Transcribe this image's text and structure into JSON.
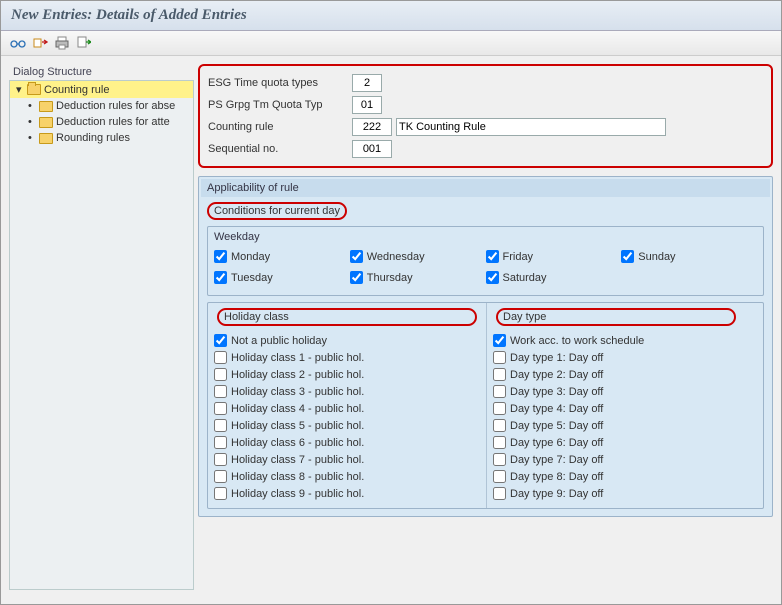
{
  "title": "New Entries: Details of Added Entries",
  "sidebar": {
    "title": "Dialog Structure",
    "items": [
      {
        "label": "Counting rule",
        "selected": true,
        "open": true
      },
      {
        "label": "Deduction rules for abse",
        "selected": false
      },
      {
        "label": "Deduction rules for atte",
        "selected": false
      },
      {
        "label": "Rounding rules",
        "selected": false
      }
    ]
  },
  "header_fields": {
    "esg_label": "ESG Time quota types",
    "esg_value": "2",
    "psgrp_label": "PS Grpg Tm Quota Typ",
    "psgrp_value": "01",
    "countrule_label": "Counting rule",
    "countrule_value": "222",
    "countrule_desc": "TK Counting Rule",
    "seqno_label": "Sequential no.",
    "seqno_value": "001"
  },
  "applicability_title": "Applicability of rule",
  "conditions_title": "Conditions for current day",
  "weekday_title": "Weekday",
  "weekdays": [
    {
      "label": "Monday",
      "checked": true
    },
    {
      "label": "Wednesday",
      "checked": true
    },
    {
      "label": "Friday",
      "checked": true
    },
    {
      "label": "Sunday",
      "checked": true
    },
    {
      "label": "Tuesday",
      "checked": true
    },
    {
      "label": "Thursday",
      "checked": true
    },
    {
      "label": "Saturday",
      "checked": true
    }
  ],
  "holiday_title": "Holiday class",
  "holiday_items": [
    {
      "label": "Not a public holiday",
      "checked": true
    },
    {
      "label": "Holiday class 1 - public hol.",
      "checked": false
    },
    {
      "label": "Holiday class 2 - public hol.",
      "checked": false
    },
    {
      "label": "Holiday class 3 - public hol.",
      "checked": false
    },
    {
      "label": "Holiday class 4 - public hol.",
      "checked": false
    },
    {
      "label": "Holiday class 5 - public hol.",
      "checked": false
    },
    {
      "label": "Holiday class 6 - public hol.",
      "checked": false
    },
    {
      "label": "Holiday class 7 - public hol.",
      "checked": false
    },
    {
      "label": "Holiday class 8 - public hol.",
      "checked": false
    },
    {
      "label": "Holiday class 9 - public hol.",
      "checked": false
    }
  ],
  "daytype_title": "Day type",
  "daytype_items": [
    {
      "label": "Work acc. to work schedule",
      "checked": true
    },
    {
      "label": "Day type 1: Day off",
      "checked": false
    },
    {
      "label": "Day type 2: Day off",
      "checked": false
    },
    {
      "label": "Day type 3: Day off",
      "checked": false
    },
    {
      "label": "Day type 4: Day off",
      "checked": false
    },
    {
      "label": "Day type 5: Day off",
      "checked": false
    },
    {
      "label": "Day type 6: Day off",
      "checked": false
    },
    {
      "label": "Day type 7: Day off",
      "checked": false
    },
    {
      "label": "Day type 8: Day off",
      "checked": false
    },
    {
      "label": "Day type 9: Day off",
      "checked": false
    }
  ]
}
